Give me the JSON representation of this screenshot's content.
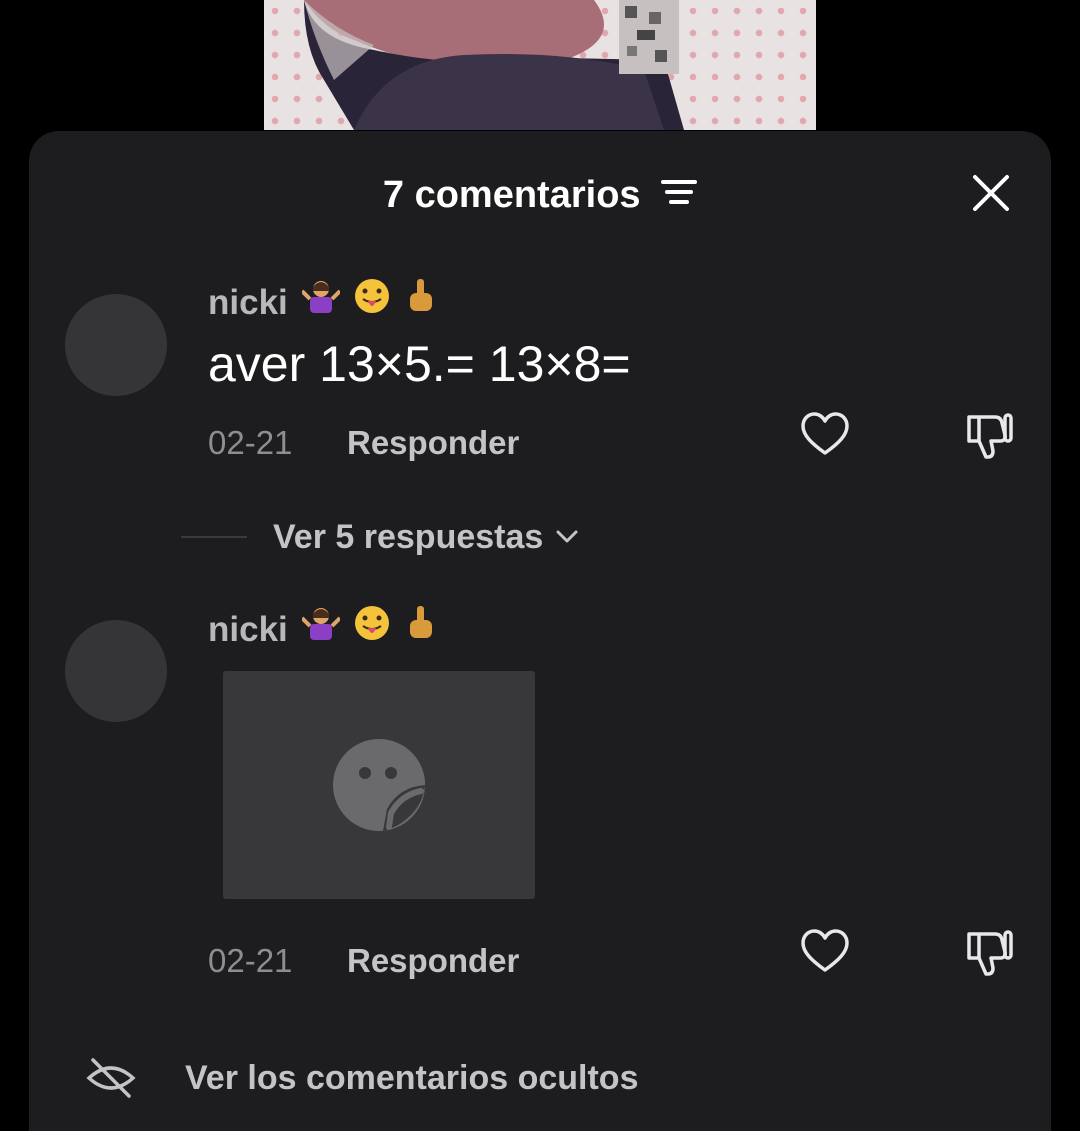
{
  "header": {
    "title": "7 comentarios",
    "filter_icon": "filter-icon",
    "close_icon": "close-icon"
  },
  "comments": [
    {
      "username": "nicki",
      "emojis": [
        "🤷‍♀️",
        "😛",
        "🖕"
      ],
      "text": "aver 13×5.= 13×8=",
      "date": "02-21",
      "reply_label": "Responder",
      "like_icon": "heart-icon",
      "dislike_icon": "thumbs-down-icon",
      "view_replies_label": "Ver 5 respuestas"
    },
    {
      "username": "nicki",
      "emojis": [
        "🤷‍♀️",
        "😛",
        "🖕"
      ],
      "sticker_icon": "sticker-placeholder-icon",
      "date": "02-21",
      "reply_label": "Responder",
      "like_icon": "heart-icon",
      "dislike_icon": "thumbs-down-icon"
    }
  ],
  "hidden_comments": {
    "label": "Ver los comentarios ocultos",
    "icon": "hidden-eye-icon"
  },
  "colors": {
    "sheet_bg": "#1d1d1f",
    "avatar": "#353537",
    "text_primary": "#ffffff",
    "text_secondary": "#8e8e90"
  }
}
